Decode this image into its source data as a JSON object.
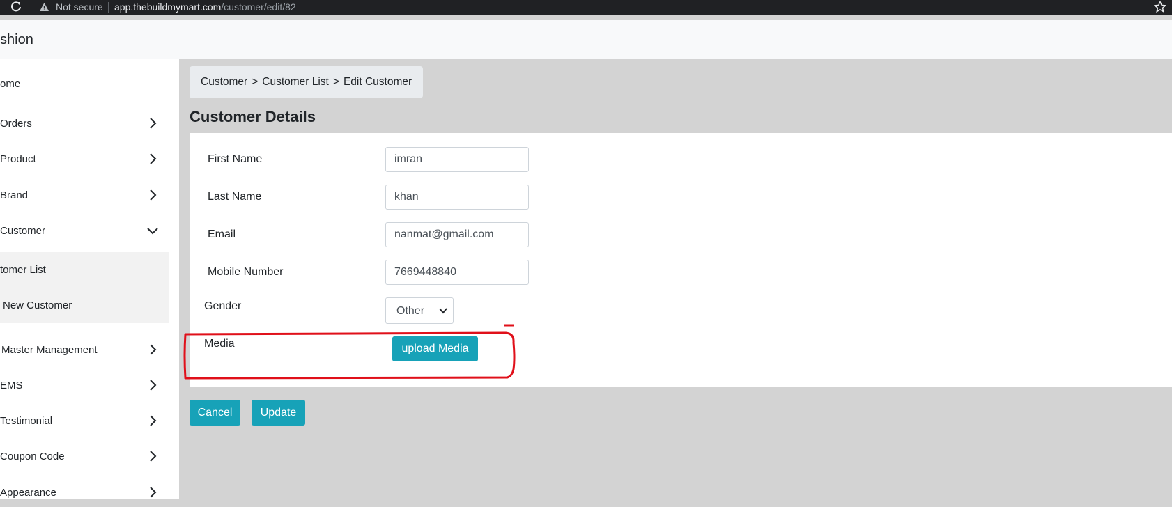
{
  "browser": {
    "security_label": "Not secure",
    "url_host": "app.thebuildmymart.com",
    "url_path": "/customer/edit/82"
  },
  "header": {
    "brand": "shion"
  },
  "sidebar": {
    "items": [
      {
        "label": "ome"
      },
      {
        "label": "Orders"
      },
      {
        "label": "Product"
      },
      {
        "label": "Brand"
      },
      {
        "label": "Customer"
      },
      {
        "label": "Master Management"
      },
      {
        "label": "EMS"
      },
      {
        "label": "Testimonial"
      },
      {
        "label": "Coupon Code"
      },
      {
        "label": "Appearance"
      }
    ],
    "submenu": [
      {
        "label": "tomer List"
      },
      {
        "label": "New Customer"
      }
    ]
  },
  "breadcrumb": {
    "items": [
      "Customer",
      "Customer List",
      "Edit Customer"
    ],
    "separator": ">"
  },
  "page": {
    "title": "Customer Details"
  },
  "form": {
    "first_name": {
      "label": "First Name",
      "value": "imran"
    },
    "last_name": {
      "label": "Last Name",
      "value": "khan"
    },
    "email": {
      "label": "Email",
      "value": "nanmat@gmail.com"
    },
    "mobile": {
      "label": "Mobile Number",
      "value": "7669448840"
    },
    "gender": {
      "label": "Gender",
      "value": "Other"
    },
    "media": {
      "label": "Media",
      "button": "upload Media"
    }
  },
  "actions": {
    "cancel": "Cancel",
    "update": "Update"
  },
  "colors": {
    "accent": "#17a2b8",
    "annotation": "#e0101a"
  }
}
